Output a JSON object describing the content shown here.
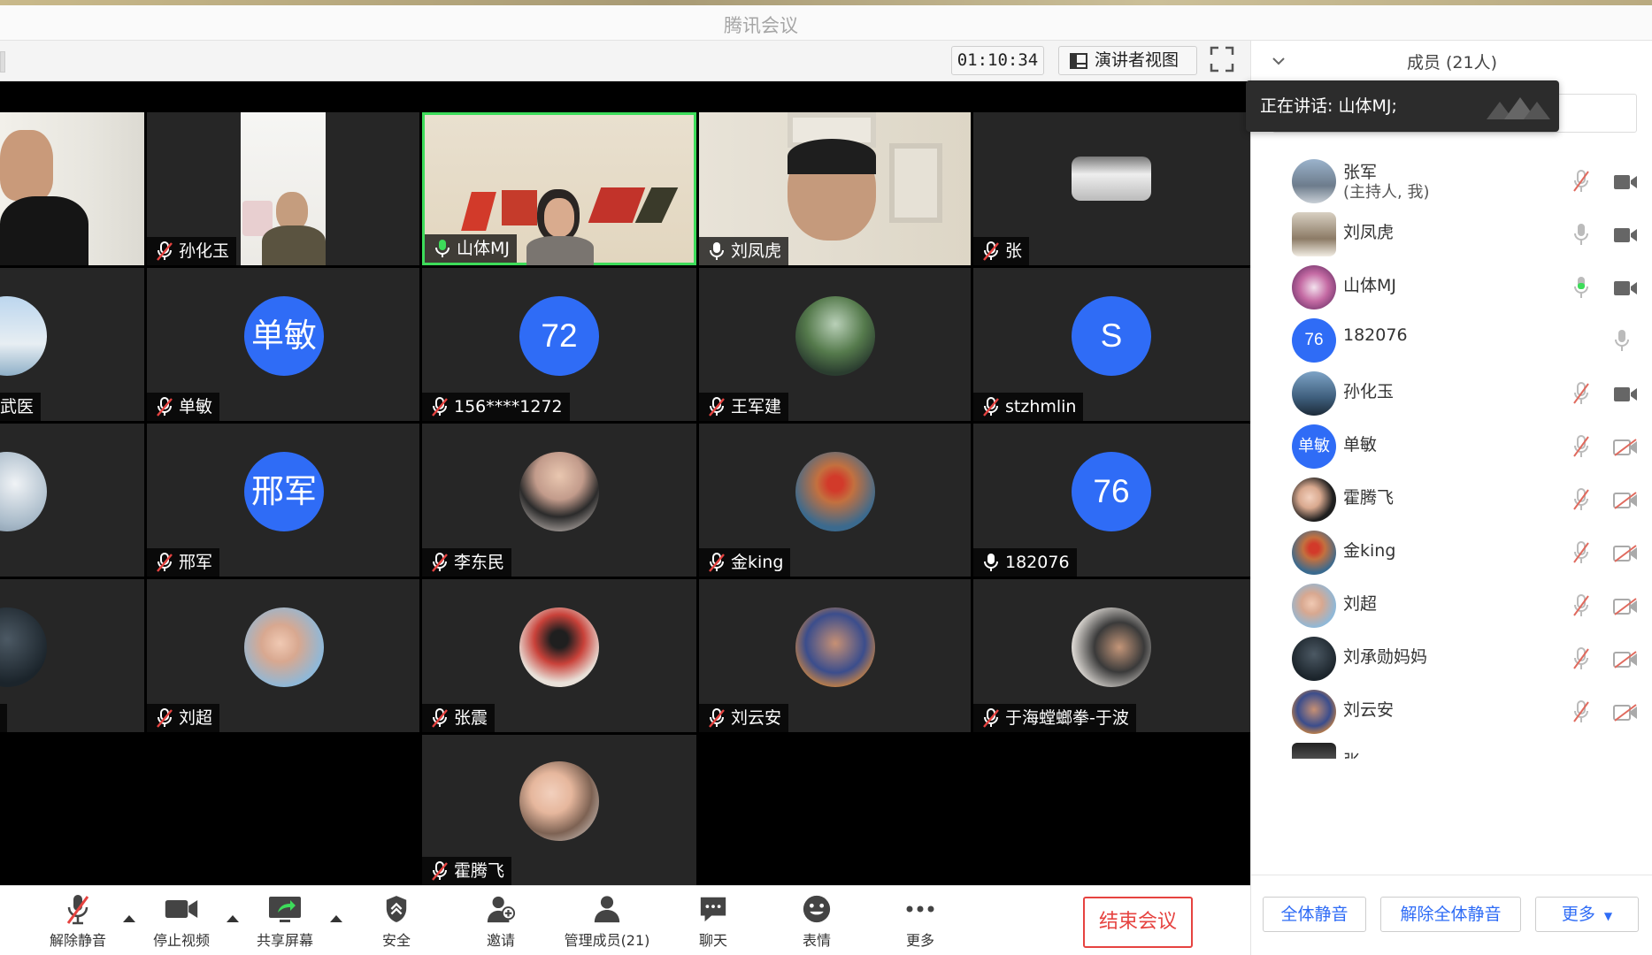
{
  "window": {
    "title": "腾讯会议"
  },
  "top": {
    "timer": "01:10:34",
    "speaker_view_label": "演讲者视图"
  },
  "panel": {
    "title": "成员 (21人)",
    "speaking_tip": "正在讲话: 山体MJ;",
    "members": [
      {
        "name": "张军",
        "sub": "(主持人, 我)",
        "mic": "muted",
        "cam": "on"
      },
      {
        "name": "刘凤虎",
        "mic": "on",
        "cam": "on"
      },
      {
        "name": "山体MJ",
        "mic": "speaking",
        "cam": "on"
      },
      {
        "name": "182076",
        "avatar_text": "76",
        "mic": "on",
        "cam": "none"
      },
      {
        "name": "孙化玉",
        "mic": "muted",
        "cam": "on"
      },
      {
        "name": "单敏",
        "avatar_text": "单敏",
        "mic": "muted",
        "cam": "off"
      },
      {
        "name": "霍腾飞",
        "mic": "muted",
        "cam": "off"
      },
      {
        "name": "金king",
        "mic": "muted",
        "cam": "off"
      },
      {
        "name": "刘超",
        "mic": "muted",
        "cam": "off"
      },
      {
        "name": "刘承勋妈妈",
        "mic": "muted",
        "cam": "off"
      },
      {
        "name": "刘云安",
        "mic": "muted",
        "cam": "off"
      },
      {
        "name": "张",
        "mic": "muted",
        "cam": "off"
      }
    ],
    "buttons": {
      "mute_all": "全体静音",
      "unmute_all": "解除全体静音",
      "more": "更多"
    }
  },
  "tiles": [
    {
      "name": "",
      "mic": "none"
    },
    {
      "name": "孙化玉",
      "mic": "muted"
    },
    {
      "name": "山体MJ",
      "mic": "speaking"
    },
    {
      "name": "刘凤虎",
      "mic": "on"
    },
    {
      "name": "张",
      "mic": "muted"
    },
    {
      "name": "武医",
      "mic": "none"
    },
    {
      "name": "单敏",
      "mic": "muted",
      "avatar_text": "单敏"
    },
    {
      "name": "156****1272",
      "mic": "muted",
      "avatar_text": "72"
    },
    {
      "name": "王军建",
      "mic": "muted"
    },
    {
      "name": "stzhmlin",
      "mic": "muted",
      "avatar_text": "S"
    },
    {
      "name": "",
      "mic": "none"
    },
    {
      "name": "邢军",
      "mic": "muted",
      "avatar_text": "邢军"
    },
    {
      "name": "李东民",
      "mic": "muted"
    },
    {
      "name": "金king",
      "mic": "muted"
    },
    {
      "name": "182076",
      "mic": "on",
      "avatar_text": "76"
    },
    {
      "name": "",
      "mic": "none"
    },
    {
      "name": "刘超",
      "mic": "muted"
    },
    {
      "name": "张震",
      "mic": "muted"
    },
    {
      "name": "刘云安",
      "mic": "muted"
    },
    {
      "name": "于海螳螂拳-于波",
      "mic": "muted"
    },
    {
      "name": "霍腾飞",
      "mic": "muted"
    }
  ],
  "toolbar": {
    "unmute": "解除静音",
    "stop_video": "停止视频",
    "share_screen": "共享屏幕",
    "security": "安全",
    "invite": "邀请",
    "manage_members": "管理成员(21)",
    "chat": "聊天",
    "emoji": "表情",
    "more": "更多",
    "end_meeting": "结束会议"
  },
  "colors": {
    "accent": "#2f6cf6",
    "danger": "#e64340",
    "speaking": "#3ddc5a",
    "tile_bg": "#262626"
  }
}
